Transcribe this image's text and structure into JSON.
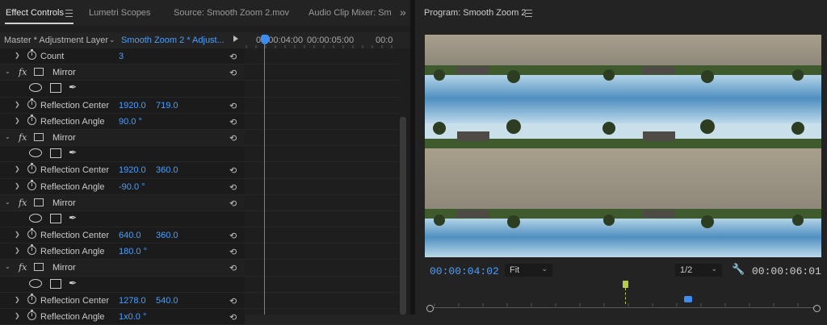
{
  "left_panel": {
    "tabs": [
      "Effect Controls",
      "Lumetri Scopes",
      "Source: Smooth Zoom 2.mov",
      "Audio Clip Mixer: Sm"
    ],
    "overflow_label": "»",
    "master_label": "Master * Adjustment Layer",
    "clip_label": "Smooth Zoom 2 * Adjust...",
    "timecodes": [
      "00:00:04:00",
      "00:00:05:00",
      "00:0"
    ],
    "rows": [
      {
        "kind": "prop",
        "label": "Count",
        "v1": "3",
        "v2": ""
      },
      {
        "kind": "fx",
        "label": "Mirror"
      },
      {
        "kind": "masks"
      },
      {
        "kind": "prop",
        "label": "Reflection Center",
        "v1": "1920.0",
        "v2": "719.0"
      },
      {
        "kind": "prop",
        "label": "Reflection Angle",
        "v1": "90.0 °",
        "v2": ""
      },
      {
        "kind": "fx",
        "label": "Mirror"
      },
      {
        "kind": "masks"
      },
      {
        "kind": "prop",
        "label": "Reflection Center",
        "v1": "1920.0",
        "v2": "360.0"
      },
      {
        "kind": "prop",
        "label": "Reflection Angle",
        "v1": "-90.0 °",
        "v2": ""
      },
      {
        "kind": "fx",
        "label": "Mirror"
      },
      {
        "kind": "masks"
      },
      {
        "kind": "prop",
        "label": "Reflection Center",
        "v1": "640.0",
        "v2": "360.0"
      },
      {
        "kind": "prop",
        "label": "Reflection Angle",
        "v1": "180.0 °",
        "v2": ""
      },
      {
        "kind": "fx",
        "label": "Mirror"
      },
      {
        "kind": "masks"
      },
      {
        "kind": "prop",
        "label": "Reflection Center",
        "v1": "1278.0",
        "v2": "540.0"
      },
      {
        "kind": "prop",
        "label": "Reflection Angle",
        "v1": "1x0.0 °",
        "v2": ""
      }
    ]
  },
  "program_monitor": {
    "title": "Program: Smooth Zoom 2",
    "current_timecode": "00:00:04:02",
    "zoom": "Fit",
    "resolution": "1/2",
    "duration_timecode": "00:00:06:01"
  },
  "colors": {
    "accent": "#4a9fff",
    "playhead": "#3d8cf0",
    "marker": "#b5cc4a"
  }
}
